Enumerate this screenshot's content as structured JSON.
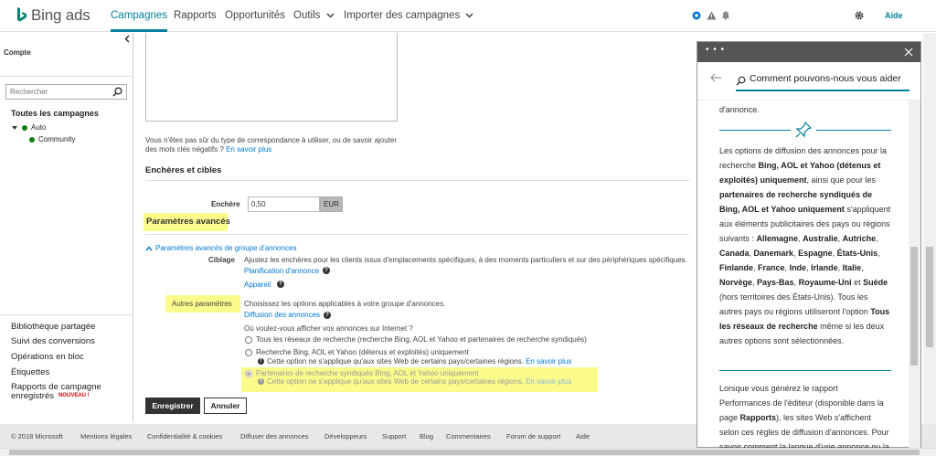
{
  "brand": {
    "logo_text": "Bing ads",
    "accent": "#00809d",
    "highlight": "#fbfb8c"
  },
  "nav": {
    "items": [
      "Campagnes",
      "Rapports",
      "Opportunités",
      "Outils",
      "Importer des campagnes"
    ],
    "help": "Aide"
  },
  "sidebar": {
    "account_label": "Compte",
    "search_placeholder": "Rechercher",
    "all_campaigns": "Toutes les campagnes",
    "tree": {
      "auto": "Auto",
      "community": "Community"
    },
    "links": [
      "Bibliothèque partagée",
      "Suivi des conversions",
      "Opérations en bloc",
      "Étiquettes",
      "Rapports de campagne enregistrés"
    ],
    "new_badge": "NOUVEAU !"
  },
  "main": {
    "match_help": {
      "line1": "Vous n'êtes pas sûr du type de correspondance à utiliser, ou de savoir ajouter",
      "line2": "des mots clés négatifs ?",
      "link": "En savoir plus"
    },
    "bids_section": "Enchères et cibles",
    "bid": {
      "label": "Enchère",
      "value": "0,50",
      "unit": "EUR"
    },
    "advanced_title": "Paramètres avancés",
    "adgroup_toggle": "Paramètres avancés de groupe d'annonces",
    "targeting": {
      "label": "Ciblage",
      "desc": "Ajustez les enchères pour les clients issus d'emplacements spécifiques, à des moments particuliers et sur des périphériques spécifiques.",
      "link1": "Planification d'annonce",
      "link2": "Appareil"
    },
    "other": {
      "label": "Autres paramètres",
      "desc": "Choisissez les options applicables à votre groupe d'annonces.",
      "link": "Diffusion des annonces",
      "question": "Où voulez-vous afficher vos annonces sur Internet ?",
      "options": [
        {
          "label": "Tous les réseaux de recherche (recherche Bing, AOL et Yahoo et partenaires de recherche syndiqués)"
        },
        {
          "label": "Recherche Bing, AOL et Yahoo (détenus et exploités) uniquement",
          "note": "Cette option ne s'applique qu'aux sites Web de certains pays/certaines régions.",
          "link": "En savoir plus"
        },
        {
          "label": "Partenaires de recherche syndiqués Bing, AOL et Yahoo uniquement",
          "note": "Cette option ne s'applique qu'aux sites Web de certains pays/certaines régions.",
          "link": "En savoir plus"
        }
      ]
    },
    "save_label": "Enregistrer",
    "cancel_label": "Annuler"
  },
  "footer": [
    "© 2018 Microsoft",
    "Mentions légales",
    "Confidentialité & cookies",
    "Diffuser des annonces",
    "Développeurs",
    "Support",
    "Blog",
    "Commentaires",
    "Forum de support",
    "Aide"
  ],
  "help_panel": {
    "dots": "• • •",
    "search_value": "Comment pouvons-nous vous aider",
    "top_fragment": "d'annonce.",
    "para1_html": "Les options de diffusion des annonces pour la recherche <b>Bing, AOL et Yahoo (détenus et exploités) uniquement</b>, ainsi que pour les <b>partenaires de recherche syndiqués de Bing, AOL et Yahoo uniquement</b> s'appliquent aux éléments publicitaires des pays ou régions suivants : <b>Allemagne</b>, <b>Australie</b>, <b>Autriche</b>, <b>Canada</b>, <b>Danemark</b>, <b>Espagne</b>, <b>États-Unis</b>, <b>Finlande</b>, <b>France</b>, <b>Inde</b>, <b>Irlande</b>, <b>Italie</b>, <b>Norvège</b>, <b>Pays-Bas</b>, <b>Royaume-Uni</b> et <b>Suède</b> (hors territoires des États-Unis). Tous les autres pays ou régions utiliseront l'option <b>Tous les réseaux de recherche</b> même si les deux autres options sont sélectionnées.",
    "para2_html": "Lorsque vous générez le rapport Performances de l'éditeur (disponible dans la page <b>Rapports</b>), les sites Web s'affichent selon ces règles de diffusion d'annonces. Pour savoir comment la langue d'une annonce ou la"
  }
}
